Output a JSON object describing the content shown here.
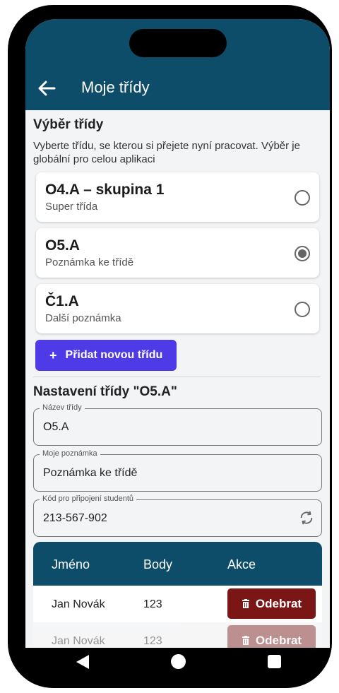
{
  "appbar": {
    "title": "Moje třídy"
  },
  "selection": {
    "title": "Výběr třídy",
    "description": "Vyberte třídu, se kterou si přejete nyní pracovat. Výběr je globální pro celou aplikaci",
    "classes": [
      {
        "name": "O4.A – skupina 1",
        "note": "Super třída",
        "selected": false
      },
      {
        "name": "O5.A",
        "note": "Poznámka ke třídě",
        "selected": true
      },
      {
        "name": "Č1.A",
        "note": "Další poznámka",
        "selected": false
      }
    ],
    "add_button": "Přidat novou třídu"
  },
  "settings": {
    "title": "Nastavení třídy \"O5.A\"",
    "fields": [
      {
        "label": "Název třídy",
        "value": "O5.A"
      },
      {
        "label": "Moje poznámka",
        "value": "Poznámka ke třídě"
      },
      {
        "label": "Kód pro připojení studentů",
        "value": "213-567-902"
      }
    ]
  },
  "students_table": {
    "headers": [
      "Jméno",
      "Body",
      "Akce"
    ],
    "rows": [
      {
        "name": "Jan Novák",
        "points": "123",
        "action": "Odebrat"
      },
      {
        "name": "Jan Novák",
        "points": "123",
        "action": "Odebrat"
      }
    ]
  },
  "colors": {
    "primary": "#0d4d6a",
    "accent": "#4f3ae8",
    "danger": "#7a1616"
  },
  "icons": [
    "arrow-left-icon",
    "plus-icon",
    "refresh-icon",
    "trash-icon",
    "nav-back-icon",
    "nav-home-icon",
    "nav-recent-icon"
  ]
}
